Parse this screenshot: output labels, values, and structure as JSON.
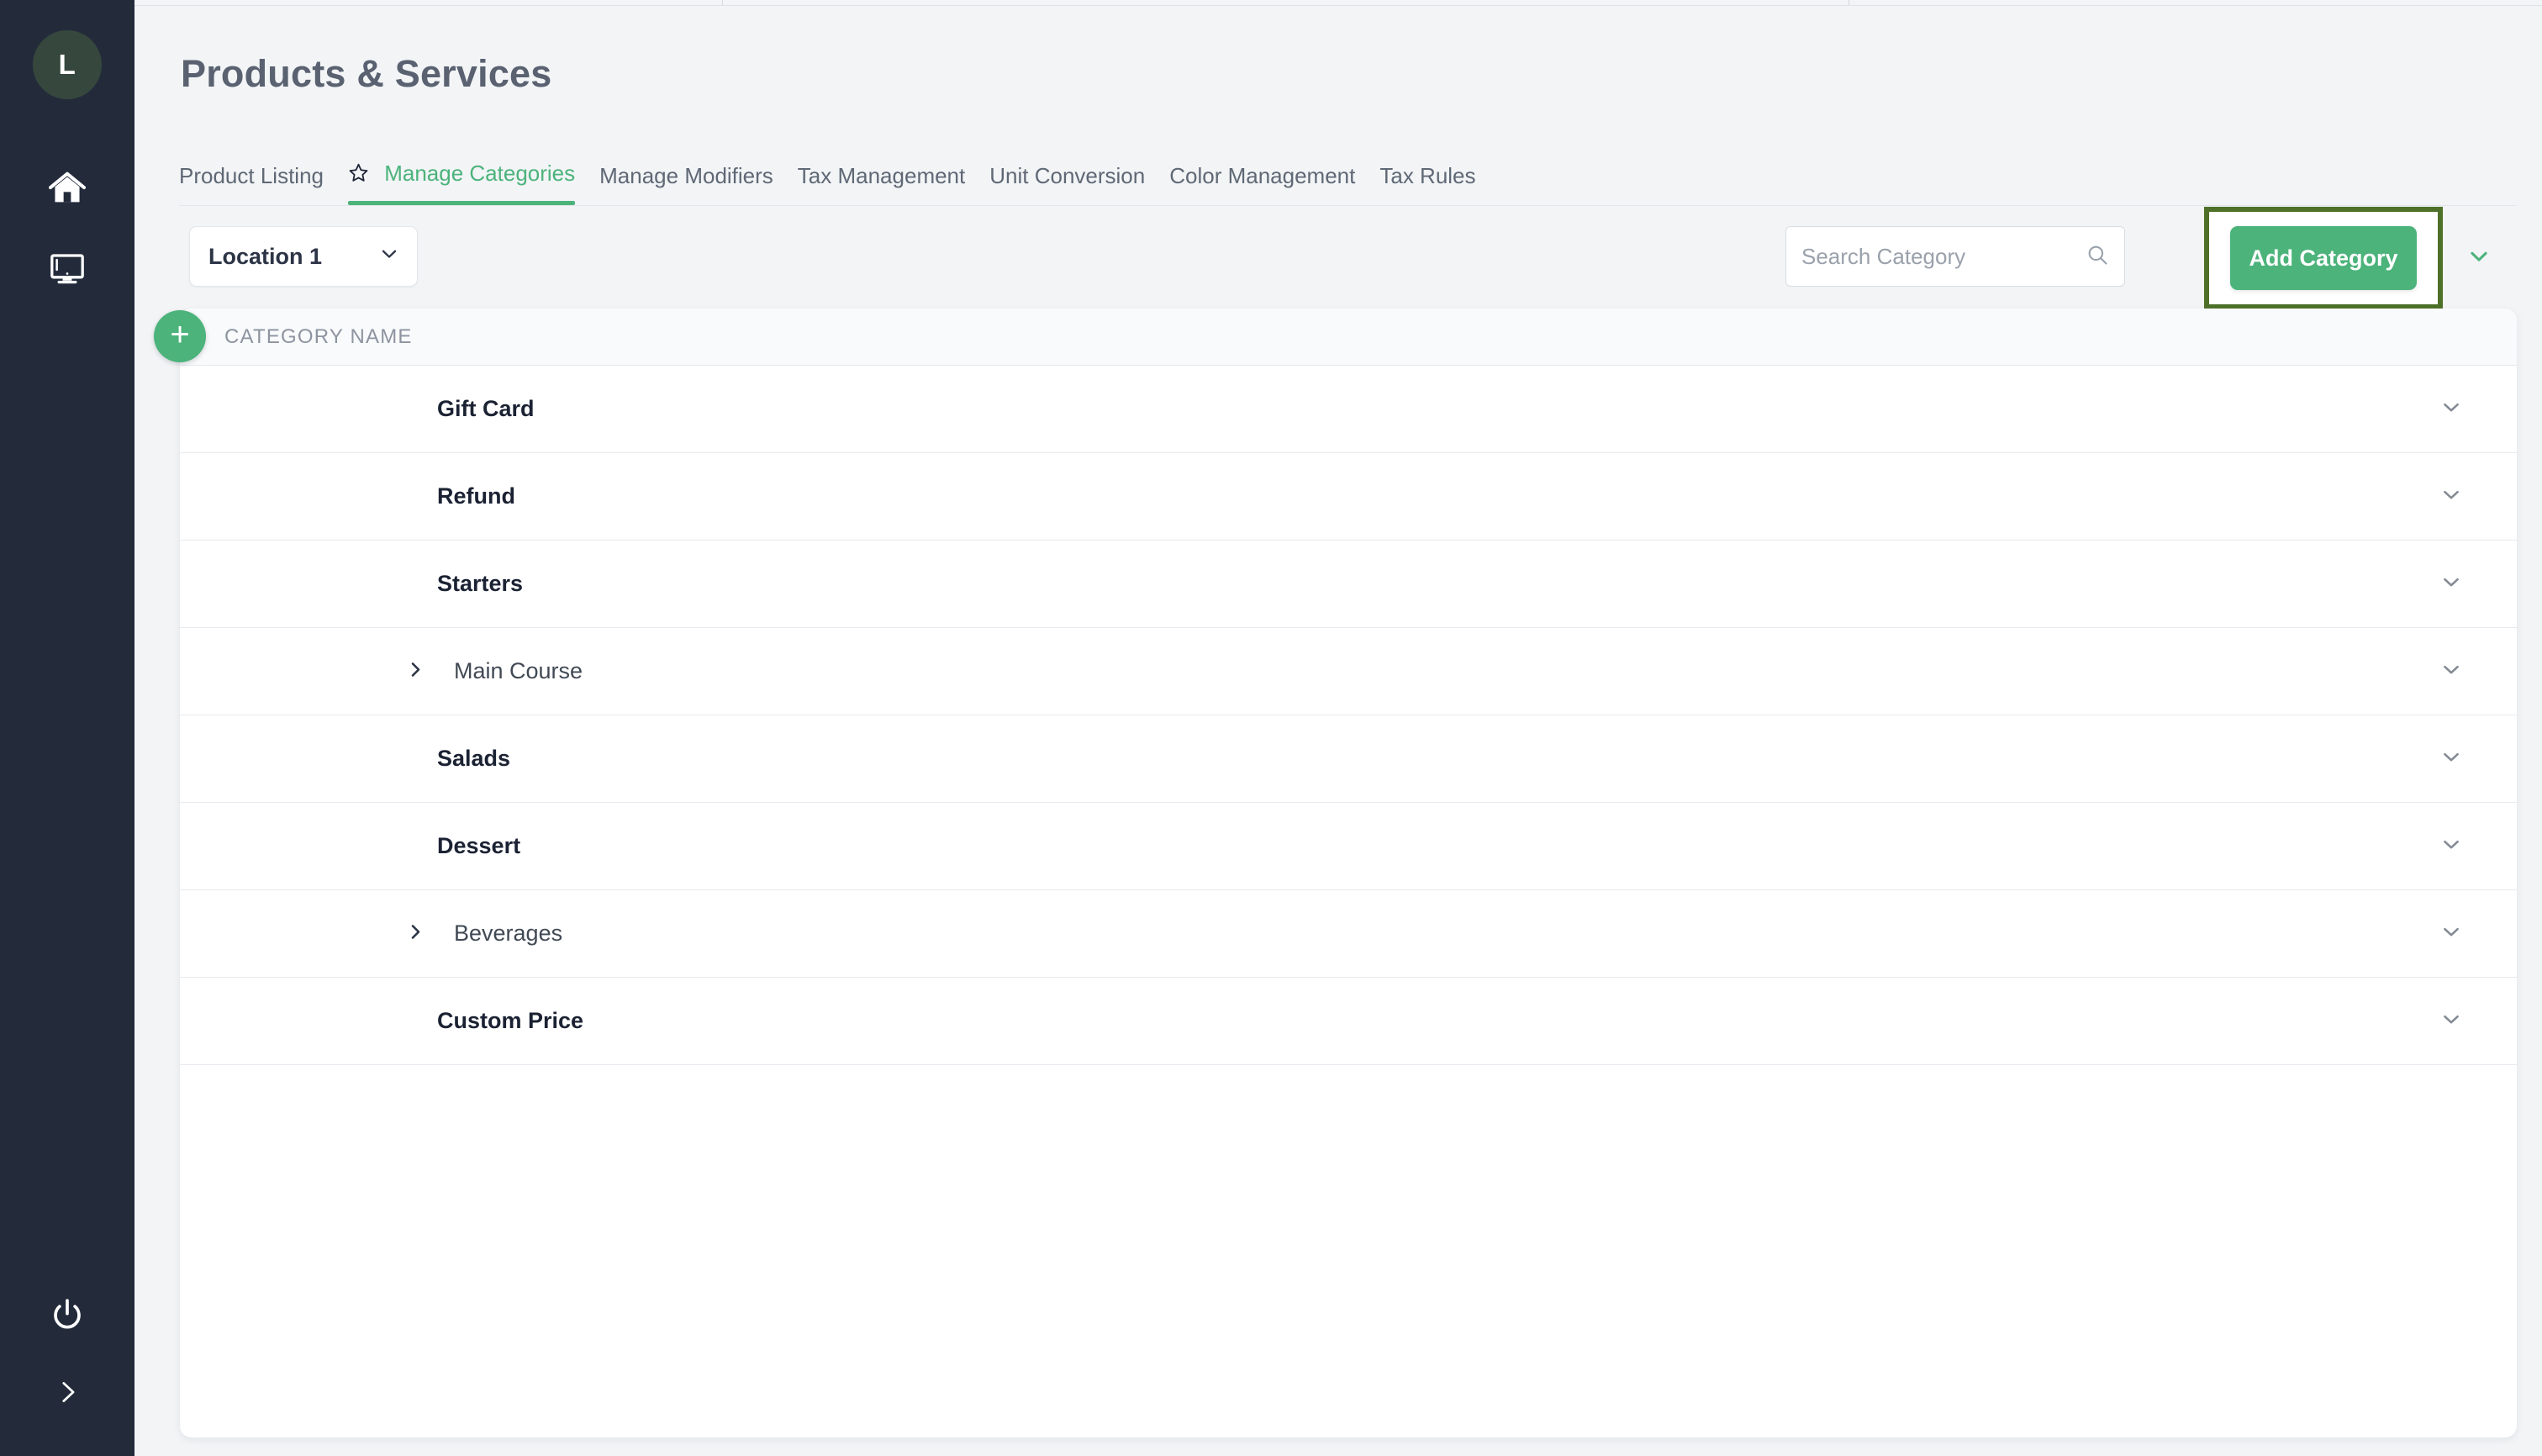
{
  "sidebar": {
    "avatar_initial": "L",
    "items": [
      {
        "name": "home-icon",
        "label": "Home"
      },
      {
        "name": "monitor-icon",
        "label": "Display"
      }
    ],
    "bottom_items": [
      {
        "name": "power-icon",
        "label": "Power"
      },
      {
        "name": "chevron-right-icon",
        "label": "Expand"
      }
    ]
  },
  "header": {
    "title": "Products & Services"
  },
  "tabs": [
    {
      "label": "Product Listing",
      "active": false,
      "star": false
    },
    {
      "label": "Manage Categories",
      "active": true,
      "star": true
    },
    {
      "label": "Manage Modifiers",
      "active": false,
      "star": false
    },
    {
      "label": "Tax Management",
      "active": false,
      "star": false
    },
    {
      "label": "Unit Conversion",
      "active": false,
      "star": false
    },
    {
      "label": "Color Management",
      "active": false,
      "star": false
    },
    {
      "label": "Tax Rules",
      "active": false,
      "star": false
    }
  ],
  "toolbar": {
    "location_value": "Location 1",
    "search_placeholder": "Search Category",
    "search_value": "",
    "add_category_label": "Add Category",
    "expand_caret": "chevron-down-icon"
  },
  "table": {
    "column_header": "CATEGORY NAME",
    "add_row_label": "+",
    "rows": [
      {
        "name": "Gift Card",
        "expandable": false
      },
      {
        "name": "Refund",
        "expandable": false
      },
      {
        "name": "Starters",
        "expandable": false
      },
      {
        "name": "Main Course",
        "expandable": true
      },
      {
        "name": "Salads",
        "expandable": false
      },
      {
        "name": "Dessert",
        "expandable": false
      },
      {
        "name": "Beverages",
        "expandable": true
      },
      {
        "name": "Custom Price",
        "expandable": false
      }
    ]
  },
  "colors": {
    "accent_green": "#4cb37b",
    "highlight_box": "#4e7028",
    "sidebar_bg": "#232b3b",
    "avatar_bg": "#36483d",
    "page_bg": "#f2f4f6",
    "title_text": "#5a6271"
  }
}
